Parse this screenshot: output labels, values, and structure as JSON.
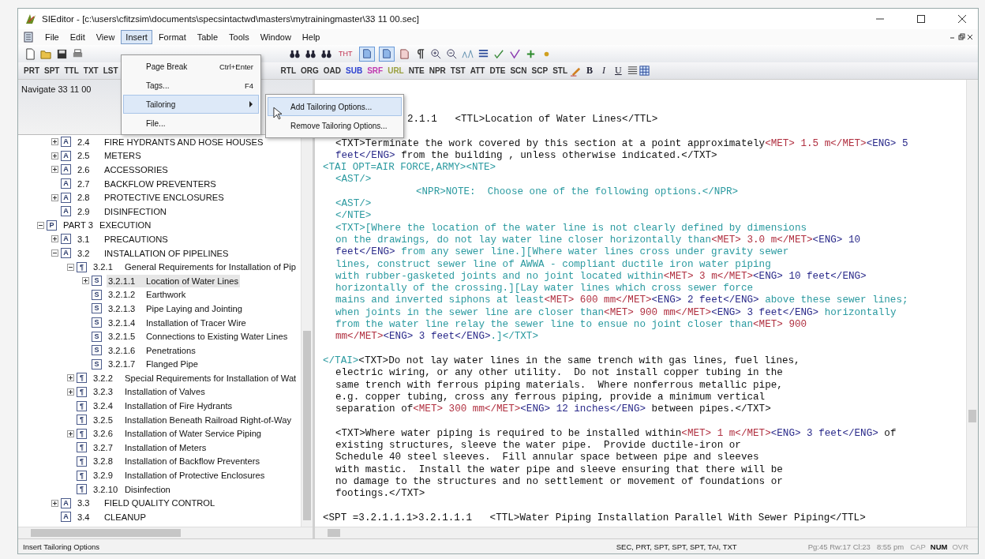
{
  "window": {
    "title": "SIEditor - [c:\\users\\cfitzsim\\documents\\specsintactwd\\masters\\mytrainingmaster\\33 11 00.sec]"
  },
  "menu_bar": [
    {
      "label": "File",
      "selected": false
    },
    {
      "label": "Edit",
      "selected": false
    },
    {
      "label": "View",
      "selected": false
    },
    {
      "label": "Insert",
      "selected": true
    },
    {
      "label": "Format",
      "selected": false
    },
    {
      "label": "Table",
      "selected": false
    },
    {
      "label": "Tools",
      "selected": false
    },
    {
      "label": "Window",
      "selected": false
    },
    {
      "label": "Help",
      "selected": false
    }
  ],
  "insert_menu": [
    {
      "label": "Page Break",
      "shortcut": "Ctrl+Enter",
      "kind": "command",
      "selected": false
    },
    {
      "label": "Tags...",
      "shortcut": "F4",
      "kind": "command",
      "selected": false
    },
    {
      "label": "Tailoring",
      "kind": "submenu",
      "selected": true
    },
    {
      "label": "File...",
      "kind": "command",
      "selected": false
    }
  ],
  "tailoring_submenu": [
    {
      "label": "Add Tailoring Options...",
      "selected": true
    },
    {
      "label": "Remove Tailoring Options...",
      "selected": false
    }
  ],
  "toolbar": {
    "text_button": "THT",
    "toggles": [
      {
        "pressed": true
      },
      {
        "pressed": true
      }
    ]
  },
  "tag_toolbar": {
    "left_tags": [
      {
        "label": "PRT",
        "color": "#333333"
      },
      {
        "label": "SPT",
        "color": "#333333"
      },
      {
        "label": "TTL",
        "color": "#333333"
      },
      {
        "label": "TXT",
        "color": "#333333"
      },
      {
        "label": "LST",
        "color": "#333333"
      }
    ],
    "right_tags": [
      {
        "label": "RTL",
        "color": "#333333"
      },
      {
        "label": "ORG",
        "color": "#333333"
      },
      {
        "label": "OAD",
        "color": "#333333"
      },
      {
        "label": "SUB",
        "color": "#2a3fd0"
      },
      {
        "label": "SRF",
        "color": "#c03ab0"
      },
      {
        "label": "URL",
        "color": "#9aa040"
      },
      {
        "label": "NTE",
        "color": "#333333"
      },
      {
        "label": "NPR",
        "color": "#333333"
      },
      {
        "label": "TST",
        "color": "#333333"
      },
      {
        "label": "ATT",
        "color": "#333333"
      },
      {
        "label": "DTE",
        "color": "#333333"
      },
      {
        "label": "SCN",
        "color": "#333333"
      },
      {
        "label": "SCP",
        "color": "#333333"
      },
      {
        "label": "STL",
        "color": "#333333"
      }
    ],
    "format_buttons": [
      "B",
      "I",
      "U"
    ]
  },
  "sidebar": {
    "header": "Navigate 33 11 00",
    "nodes": [
      {
        "kind": "article",
        "icon": "A",
        "number": "2.4",
        "title": "FIRE HYDRANTS AND HOSE HOUSES",
        "expanded": false,
        "selected": false
      },
      {
        "kind": "article",
        "icon": "A",
        "number": "2.5",
        "title": "METERS",
        "expanded": false,
        "selected": false
      },
      {
        "kind": "article",
        "icon": "A",
        "number": "2.6",
        "title": "ACCESSORIES",
        "expanded": false,
        "selected": false
      },
      {
        "kind": "article",
        "icon": "A",
        "number": "2.7",
        "title": "BACKFLOW PREVENTERS",
        "selected": false
      },
      {
        "kind": "article",
        "icon": "A",
        "number": "2.8",
        "title": "PROTECTIVE ENCLOSURES",
        "expanded": false,
        "selected": false
      },
      {
        "kind": "article",
        "icon": "A",
        "number": "2.9",
        "title": "DISINFECTION",
        "selected": false
      },
      {
        "kind": "part",
        "icon": "P",
        "number": "PART 3",
        "title": "EXECUTION",
        "expanded": true,
        "selected": false,
        "children": [
          {
            "kind": "article",
            "icon": "A",
            "number": "3.1",
            "title": "PRECAUTIONS",
            "expanded": false,
            "selected": false
          },
          {
            "kind": "article",
            "icon": "A",
            "number": "3.2",
            "title": "INSTALLATION OF PIPELINES",
            "expanded": true,
            "selected": false,
            "children": [
              {
                "kind": "paragraph",
                "icon": "¶",
                "number": "3.2.1",
                "title": "General Requirements for Installation of Pip",
                "expanded": true,
                "selected": false,
                "children": [
                  {
                    "kind": "subparagraph",
                    "icon": "S",
                    "number": "3.2.1.1",
                    "title": "Location of Water Lines",
                    "expanded": false,
                    "selected": true
                  },
                  {
                    "kind": "subparagraph",
                    "icon": "S",
                    "number": "3.2.1.2",
                    "title": "Earthwork",
                    "selected": false
                  },
                  {
                    "kind": "subparagraph",
                    "icon": "S",
                    "number": "3.2.1.3",
                    "title": "Pipe Laying and Jointing",
                    "selected": false
                  },
                  {
                    "kind": "subparagraph",
                    "icon": "S",
                    "number": "3.2.1.4",
                    "title": "Installation of Tracer Wire",
                    "selected": false
                  },
                  {
                    "kind": "subparagraph",
                    "icon": "S",
                    "number": "3.2.1.5",
                    "title": "Connections to Existing Water Lines",
                    "selected": false
                  },
                  {
                    "kind": "subparagraph",
                    "icon": "S",
                    "number": "3.2.1.6",
                    "title": "Penetrations",
                    "selected": false
                  },
                  {
                    "kind": "subparagraph",
                    "icon": "S",
                    "number": "3.2.1.7",
                    "title": "Flanged Pipe",
                    "selected": false
                  }
                ]
              },
              {
                "kind": "paragraph",
                "icon": "¶",
                "number": "3.2.2",
                "title": "Special Requirements for Installation of Wat",
                "expanded": false,
                "selected": false
              },
              {
                "kind": "paragraph",
                "icon": "¶",
                "number": "3.2.3",
                "title": "Installation of Valves",
                "expanded": false,
                "selected": false
              },
              {
                "kind": "paragraph",
                "icon": "¶",
                "number": "3.2.4",
                "title": "Installation of Fire Hydrants",
                "selected": false
              },
              {
                "kind": "paragraph",
                "icon": "¶",
                "number": "3.2.5",
                "title": "Installation Beneath Railroad Right-of-Way",
                "selected": false
              },
              {
                "kind": "paragraph",
                "icon": "¶",
                "number": "3.2.6",
                "title": "Installation of Water Service Piping",
                "expanded": false,
                "selected": false
              },
              {
                "kind": "paragraph",
                "icon": "¶",
                "number": "3.2.7",
                "title": "Installation of Meters",
                "selected": false
              },
              {
                "kind": "paragraph",
                "icon": "¶",
                "number": "3.2.8",
                "title": "Installation of Backflow Preventers",
                "selected": false
              },
              {
                "kind": "paragraph",
                "icon": "¶",
                "number": "3.2.9",
                "title": "Installation of Protective Enclosures",
                "selected": false
              },
              {
                "kind": "paragraph",
                "icon": "¶",
                "number": "3.2.10",
                "title": "Disinfection",
                "selected": false
              }
            ]
          },
          {
            "kind": "article",
            "icon": "A",
            "number": "3.3",
            "title": "FIELD QUALITY CONTROL",
            "expanded": false,
            "selected": false
          },
          {
            "kind": "article",
            "icon": "A",
            "number": "3.4",
            "title": "CLEANUP",
            "selected": false
          }
        ]
      }
    ]
  },
  "editor": {
    "lines": [
      {
        "kind": "covered",
        "segments": [
          {
            "kind": "plain",
            "text": "2.1.1   <TTL>Location of Water Lines</TTL>"
          }
        ]
      },
      {
        "kind": "blank"
      },
      {
        "kind": "body",
        "segments": [
          {
            "kind": "plain",
            "text": "<TXT>Terminate the work covered by this section at a point approximately"
          },
          {
            "kind": "met",
            "text": "<MET> 1.5 m</MET>"
          },
          {
            "kind": "eng",
            "text": "<ENG> 5"
          }
        ]
      },
      {
        "kind": "body",
        "segments": [
          {
            "kind": "eng",
            "text": "feet</ENG>"
          },
          {
            "kind": "plain",
            "text": " from the building , unless otherwise indicated.</TXT>"
          }
        ]
      },
      {
        "kind": "flush",
        "segments": [
          {
            "kind": "tai",
            "text": "<TAI OPT=AIR FORCE,ARMY><NTE>"
          }
        ]
      },
      {
        "kind": "body",
        "segments": [
          {
            "kind": "tai",
            "text": "<AST/>"
          }
        ]
      },
      {
        "kind": "note",
        "segments": [
          {
            "kind": "tai",
            "text": "<NPR>NOTE:  Choose one of the following options.</NPR>"
          }
        ]
      },
      {
        "kind": "body",
        "segments": [
          {
            "kind": "tai",
            "text": "<AST/>"
          }
        ]
      },
      {
        "kind": "body",
        "segments": [
          {
            "kind": "tai",
            "text": "</NTE>"
          }
        ]
      },
      {
        "kind": "body",
        "segments": [
          {
            "kind": "tai",
            "text": "<TXT>[Where the location of the water line is not clearly defined by dimensions"
          }
        ]
      },
      {
        "kind": "body",
        "segments": [
          {
            "kind": "tai",
            "text": "on the drawings, do not lay water line closer horizontally than"
          },
          {
            "kind": "met",
            "text": "<MET> 3.0 m</MET>"
          },
          {
            "kind": "eng",
            "text": "<ENG> 10"
          }
        ]
      },
      {
        "kind": "body",
        "segments": [
          {
            "kind": "eng",
            "text": "feet</ENG>"
          },
          {
            "kind": "tai",
            "text": " from any sewer line.][Where water lines cross under gravity sewer"
          }
        ]
      },
      {
        "kind": "body",
        "segments": [
          {
            "kind": "tai",
            "text": "lines, construct sewer line of AWWA - compliant ductile iron water piping"
          }
        ]
      },
      {
        "kind": "body",
        "segments": [
          {
            "kind": "tai",
            "text": "with rubber-gasketed joints and no joint located within"
          },
          {
            "kind": "met",
            "text": "<MET> 3 m</MET>"
          },
          {
            "kind": "eng",
            "text": "<ENG> 10 feet</ENG>"
          }
        ]
      },
      {
        "kind": "body",
        "segments": [
          {
            "kind": "tai",
            "text": "horizontally of the crossing.][Lay water lines which cross sewer force"
          }
        ]
      },
      {
        "kind": "body",
        "segments": [
          {
            "kind": "tai",
            "text": "mains and inverted siphons at least"
          },
          {
            "kind": "met",
            "text": "<MET> 600 mm</MET>"
          },
          {
            "kind": "eng",
            "text": "<ENG> 2 feet</ENG>"
          },
          {
            "kind": "tai",
            "text": " above these sewer lines;"
          }
        ]
      },
      {
        "kind": "body",
        "segments": [
          {
            "kind": "tai",
            "text": "when joints in the sewer line are closer than"
          },
          {
            "kind": "met",
            "text": "<MET> 900 mm</MET>"
          },
          {
            "kind": "eng",
            "text": "<ENG> 3 feet</ENG>"
          },
          {
            "kind": "tai",
            "text": " horizontally"
          }
        ]
      },
      {
        "kind": "body",
        "segments": [
          {
            "kind": "tai",
            "text": "from the water line relay the sewer line to ensue no joint closer than"
          },
          {
            "kind": "met",
            "text": "<MET> 900"
          }
        ]
      },
      {
        "kind": "body",
        "segments": [
          {
            "kind": "met",
            "text": "mm</MET>"
          },
          {
            "kind": "eng",
            "text": "<ENG> 3 feet</ENG>"
          },
          {
            "kind": "tai",
            "text": ".]</TXT>"
          }
        ]
      },
      {
        "kind": "blank"
      },
      {
        "kind": "flush",
        "segments": [
          {
            "kind": "tai",
            "text": "</TAI>"
          },
          {
            "kind": "plain",
            "text": "<TXT>Do not lay water lines in the same trench with gas lines, fuel lines,"
          }
        ]
      },
      {
        "kind": "body",
        "segments": [
          {
            "kind": "plain",
            "text": "electric wiring, or any other utility.  Do not install copper tubing in the"
          }
        ]
      },
      {
        "kind": "body",
        "segments": [
          {
            "kind": "plain",
            "text": "same trench with ferrous piping materials.  Where nonferrous metallic pipe,"
          }
        ]
      },
      {
        "kind": "body",
        "segments": [
          {
            "kind": "plain",
            "text": "e.g. copper tubing, cross any ferrous piping, provide a minimum vertical"
          }
        ]
      },
      {
        "kind": "body",
        "segments": [
          {
            "kind": "plain",
            "text": "separation of"
          },
          {
            "kind": "met",
            "text": "<MET> 300 mm</MET>"
          },
          {
            "kind": "eng",
            "text": "<ENG> 12 inches</ENG>"
          },
          {
            "kind": "plain",
            "text": " between pipes.</TXT>"
          }
        ]
      },
      {
        "kind": "blank"
      },
      {
        "kind": "body",
        "segments": [
          {
            "kind": "plain",
            "text": "<TXT>Where water piping is required to be installed within"
          },
          {
            "kind": "met",
            "text": "<MET> 1 m</MET>"
          },
          {
            "kind": "eng",
            "text": "<ENG> 3 feet</ENG>"
          },
          {
            "kind": "plain",
            "text": " of"
          }
        ]
      },
      {
        "kind": "body",
        "segments": [
          {
            "kind": "plain",
            "text": "existing structures, sleeve the water pipe.  Provide ductile-iron or"
          }
        ]
      },
      {
        "kind": "body",
        "segments": [
          {
            "kind": "plain",
            "text": "Schedule 40 steel sleeves.  Fill annular space between pipe and sleeves"
          }
        ]
      },
      {
        "kind": "body",
        "segments": [
          {
            "kind": "plain",
            "text": "with mastic.  Install the water pipe and sleeve ensuring that there will be"
          }
        ]
      },
      {
        "kind": "body",
        "segments": [
          {
            "kind": "plain",
            "text": "no damage to the structures and no settlement or movement of foundations or"
          }
        ]
      },
      {
        "kind": "body",
        "segments": [
          {
            "kind": "plain",
            "text": "footings.</TXT>"
          }
        ]
      },
      {
        "kind": "blank"
      },
      {
        "kind": "flush",
        "segments": [
          {
            "kind": "plain",
            "text": "<SPT =3.2.1.1.1>3.2.1.1.1   <TTL>Water Piping Installation Parallel With Sewer Piping</TTL>"
          }
        ]
      }
    ]
  },
  "status_bar": {
    "message": "Insert Tailoring Options",
    "tags": "SEC, PRT, SPT, SPT, SPT, TAI, TXT",
    "position": "Pg:45 Rw:17 Cl:23",
    "time": "8:55 pm",
    "indicators": [
      {
        "label": "CAP",
        "on": false
      },
      {
        "label": "NUM",
        "on": true
      },
      {
        "label": "OVR",
        "on": false
      }
    ]
  }
}
